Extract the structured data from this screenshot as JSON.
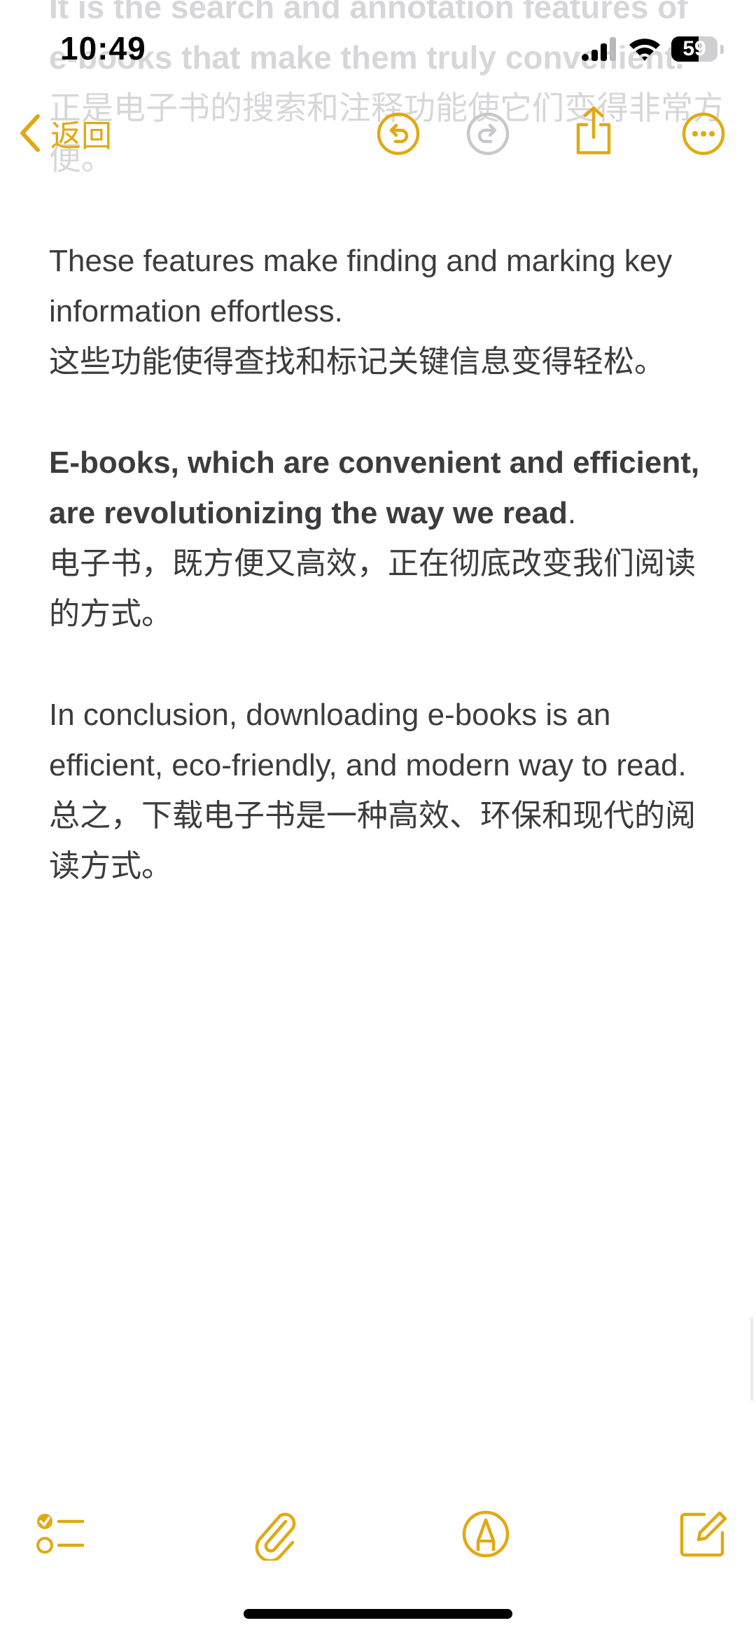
{
  "status_bar": {
    "time": "10:49",
    "battery_level": "59"
  },
  "scrolled_text": {
    "line1": "It is the search and annotation features of",
    "line2": "e-books that make them truly convenient.",
    "line3": "正是电子书的搜索和注释功能使它们变得非常方",
    "line4": "便。"
  },
  "nav": {
    "back_label": "返回"
  },
  "note": {
    "p1_en": "These features make finding and marking key information effortless.",
    "p1_zh": "这些功能使得查找和标记关键信息变得轻松。",
    "p2_en_bold": "E-books, which are convenient and efficient, are revolutionizing the way we read",
    "p2_en_tail": ".",
    "p2_zh": "电子书，既方便又高效，正在彻底改变我们阅读的方式。",
    "p3_en": "In conclusion, downloading e-books is an efficient, eco-friendly, and modern way to read.",
    "p3_zh": "总之，下载电子书是一种高效、环保和现代的阅读方式。"
  },
  "colors": {
    "accent": "#e0a914",
    "disabled": "#c7c7cc",
    "text": "#3c3c3e"
  }
}
